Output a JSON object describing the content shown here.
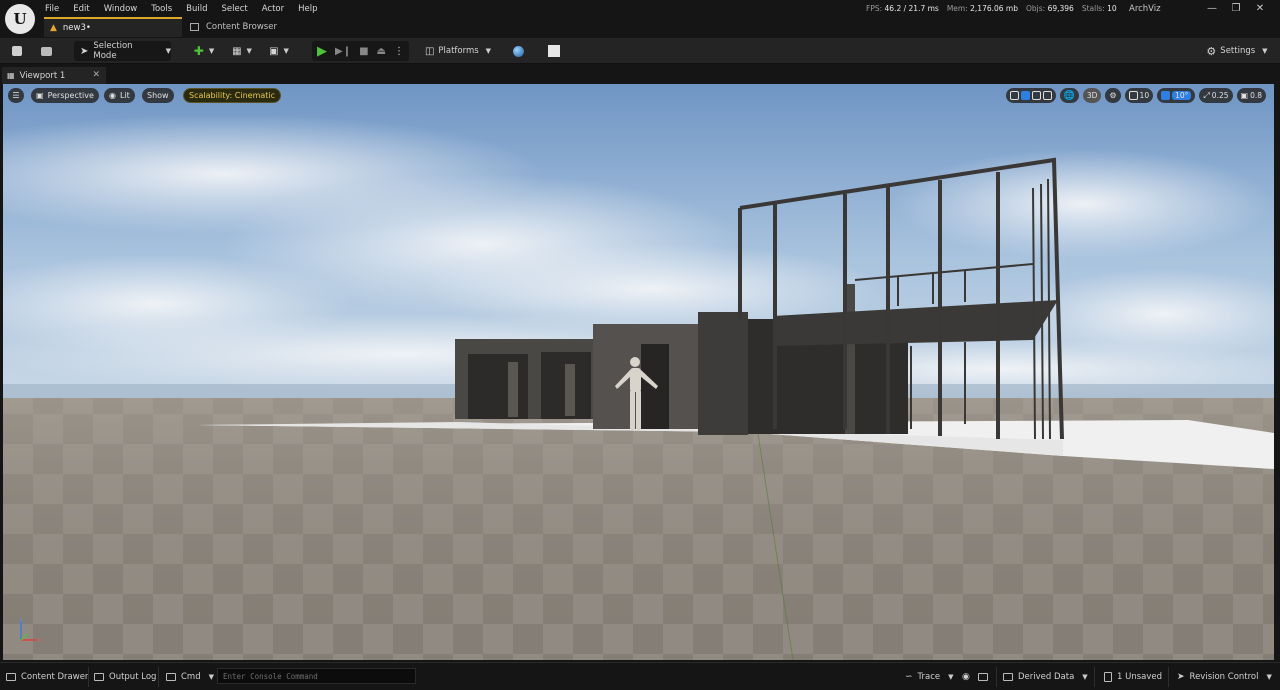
{
  "app": {
    "menu": [
      "File",
      "Edit",
      "Window",
      "Tools",
      "Build",
      "Select",
      "Actor",
      "Help"
    ],
    "doc_tab": "new3•",
    "content_browser_tab": "Content Browser",
    "project_name": "ArchViz",
    "stats": {
      "fps_label": "FPS:",
      "fps_value": "46.2",
      "ms_value": "/ 21.7 ms",
      "mem_label": "Mem:",
      "mem_value": "2,176.06 mb",
      "objs_label": "Objs:",
      "objs_value": "69,396",
      "stalls_label": "Stalls:",
      "stalls_value": "10"
    }
  },
  "toolbar": {
    "selection_mode": "Selection Mode",
    "platforms": "Platforms",
    "settings": "Settings"
  },
  "viewport": {
    "tab_label": "Viewport 1",
    "perspective": "Perspective",
    "lit": "Lit",
    "show": "Show",
    "scalability": "Scalability: Cinematic",
    "mode_3d": "3D",
    "grid_snap": "10",
    "angle_snap": "10°",
    "scale_snap": "0.25",
    "camera_speed": "0.8"
  },
  "statusbar": {
    "content_drawer": "Content Drawer",
    "output_log": "Output Log",
    "cmd": "Cmd",
    "console_placeholder": "Enter Console Command",
    "trace": "Trace",
    "derived_data": "Derived Data",
    "unsaved": "1 Unsaved",
    "revision_control": "Revision Control"
  },
  "colors": {
    "accent_tab": "#dba82a",
    "play_green": "#4fc23a",
    "active_blue": "#2f7fe0",
    "scalability_text": "#e8c84a"
  }
}
